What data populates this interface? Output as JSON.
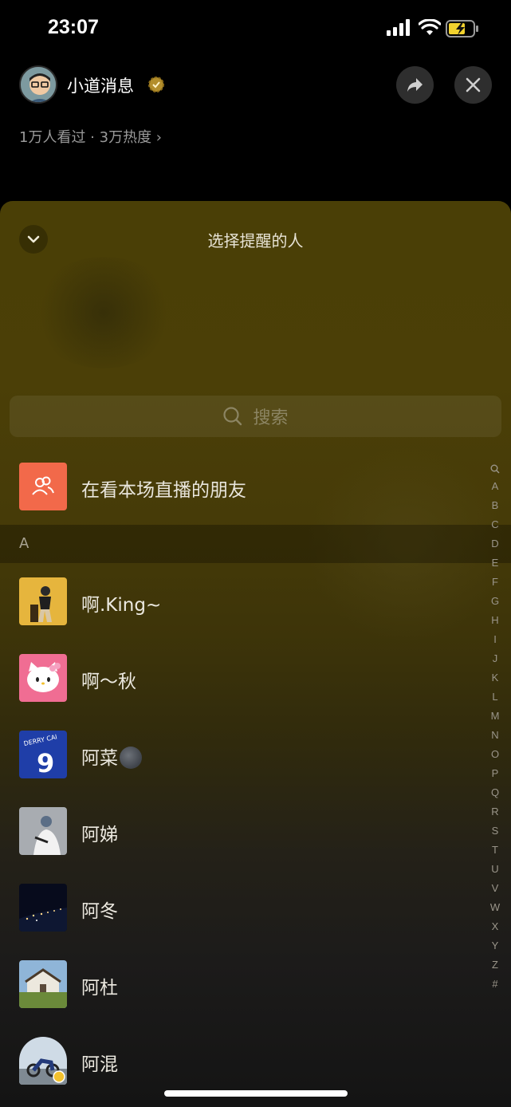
{
  "status_bar": {
    "time": "23:07"
  },
  "header": {
    "host_name": "小道消息",
    "stats": "1万人看过 · 3万热度 ›"
  },
  "sheet": {
    "title": "选择提醒的人",
    "search_placeholder": "搜索",
    "watching_friends_label": "在看本场直播的朋友",
    "section_letter": "A",
    "contacts": [
      {
        "name": "啊.King~"
      },
      {
        "name": "啊～秋"
      },
      {
        "name": "阿菜"
      },
      {
        "name": "阿娣"
      },
      {
        "name": "阿冬"
      },
      {
        "name": "阿杜"
      },
      {
        "name": "阿混"
      }
    ],
    "index_letters": [
      "Q",
      "A",
      "B",
      "C",
      "D",
      "E",
      "F",
      "G",
      "H",
      "I",
      "J",
      "K",
      "L",
      "M",
      "N",
      "O",
      "P",
      "Q",
      "R",
      "S",
      "T",
      "U",
      "V",
      "W",
      "X",
      "Y",
      "Z",
      "#"
    ]
  },
  "colors": {
    "friends_icon_bg": "#f2694a",
    "sheet_top": "#4a3f06",
    "sheet_bottom": "#141414"
  },
  "icons": {
    "share": "share-arrow-icon",
    "close": "close-icon",
    "collapse": "chevron-down-icon",
    "search": "search-icon",
    "friends": "group-people-icon"
  }
}
